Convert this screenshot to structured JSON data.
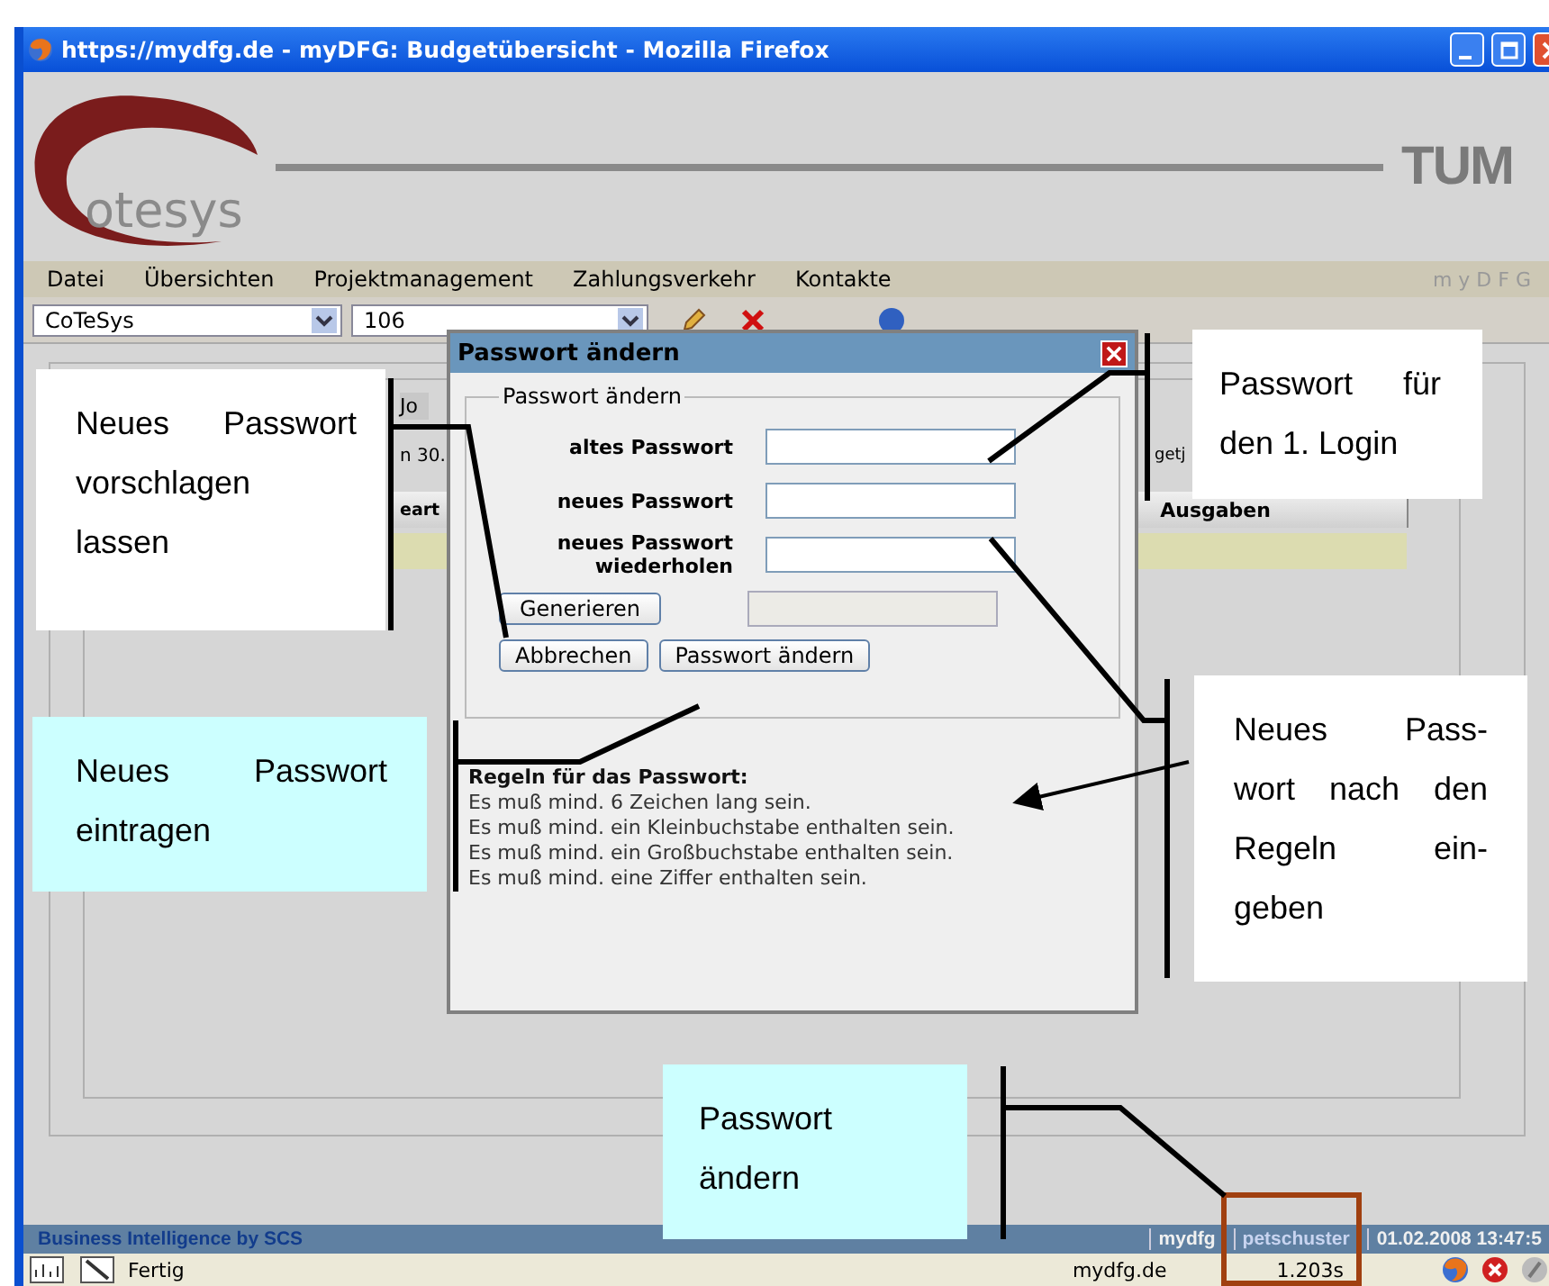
{
  "window": {
    "title": "https://mydfg.de - myDFG: Budgetübersicht - Mozilla Firefox"
  },
  "banner": {
    "logo_text": "otesys",
    "emblem_text": "TUM"
  },
  "menu": {
    "items": [
      "Datei",
      "Übersichten",
      "Projektmanagement",
      "Zahlungsverkehr",
      "Kontakte"
    ],
    "brand": "m y D F G"
  },
  "toolbar": {
    "selects": [
      {
        "value": "CoTeSys"
      },
      {
        "value": "106"
      }
    ]
  },
  "content": {
    "tab": "Jo",
    "date_fragment": "n 30.",
    "button_fragment": "getj",
    "column_fragment": "eart",
    "column_header": "Ausgaben"
  },
  "dialog": {
    "title": "Passwort ändern",
    "legend": "Passwort ändern",
    "fields": [
      {
        "label": "altes Passwort"
      },
      {
        "label": "neues Passwort"
      },
      {
        "label": "neues Passwort wiederholen"
      }
    ],
    "generate_button": "Generieren",
    "generated_field": {
      "disabled": true
    },
    "buttons": [
      "Abbrechen",
      "Passwort ändern"
    ],
    "rules_title": "Regeln für das Passwort:",
    "rules": [
      "Es muß mind. 6 Zeichen lang sein.",
      "Es muß mind. ein Kleinbuchstabe enthalten sein.",
      "Es muß mind. ein Großbuchstabe enthalten sein.",
      "Es muß mind. eine Ziffer enthalten sein."
    ]
  },
  "status_bar": {
    "brand": "Business Intelligence by SCS",
    "items": [
      {
        "text": "mydfg",
        "highlighted": false
      },
      {
        "text": "petschuster",
        "highlighted": true
      },
      {
        "text": "01.02.2008 13:47:5",
        "highlighted": false
      }
    ]
  },
  "browser_status": {
    "text": "Fertig",
    "host": "mydfg.de",
    "timing": "1.203s"
  },
  "callouts": [
    {
      "kind": "white",
      "lines": [
        "Neues Passwort",
        "vorschlagen",
        "lassen"
      ]
    },
    {
      "kind": "white",
      "lines": [
        "Passwort für",
        "den 1. Login"
      ]
    },
    {
      "kind": "cyan",
      "lines": [
        "Neues Passwort",
        "eintragen"
      ]
    },
    {
      "kind": "white",
      "lines": [
        "Neues Pass-",
        "wort nach den",
        "Regeln ein-",
        "geben"
      ]
    },
    {
      "kind": "cyan",
      "lines": [
        "Passwort",
        "ändern"
      ]
    }
  ]
}
